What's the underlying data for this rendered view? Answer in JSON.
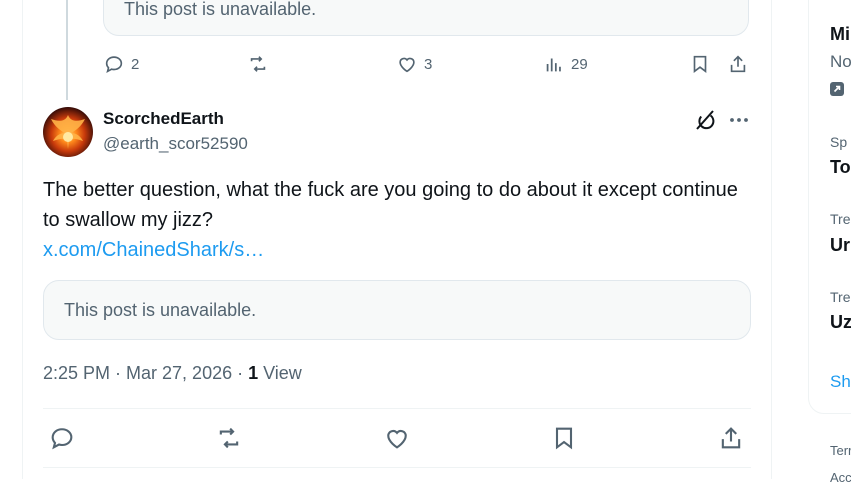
{
  "quoted_top": {
    "text": "This post is unavailable."
  },
  "small_actions": {
    "replies": "2",
    "reposts": "",
    "likes": "3",
    "views": "29"
  },
  "post": {
    "display_name": "ScorchedEarth",
    "handle": "@earth_scor52590",
    "text": "The better question, what the fuck are you going to do about it except continue to swallow my jizz?",
    "link": "x.com/ChainedShark/s…",
    "quoted": "This post is unavailable.",
    "time": "2:25 PM · Mar 27, 2026 · ",
    "view_count": "1",
    "view_label": " View"
  },
  "sidebar": {
    "item1_title": "Mi",
    "item1_sub": "No",
    "item2_small": "Sp",
    "item2_title": "To",
    "item3_small": "Tre",
    "item3_title": "Ur",
    "item4_small": "Tre",
    "item4_title": "Uz",
    "show_more": "Sh",
    "footer1": "Terr",
    "footer2": "Acc"
  },
  "colors": {
    "text": "#0f1419",
    "secondary": "#536471",
    "link": "#1d9bf0",
    "border": "#eff3f4"
  },
  "icons": [
    "reply-icon",
    "repost-icon",
    "like-icon",
    "views-icon",
    "bookmark-icon",
    "share-icon",
    "grok-icon",
    "more-icon",
    "external-link-icon"
  ]
}
